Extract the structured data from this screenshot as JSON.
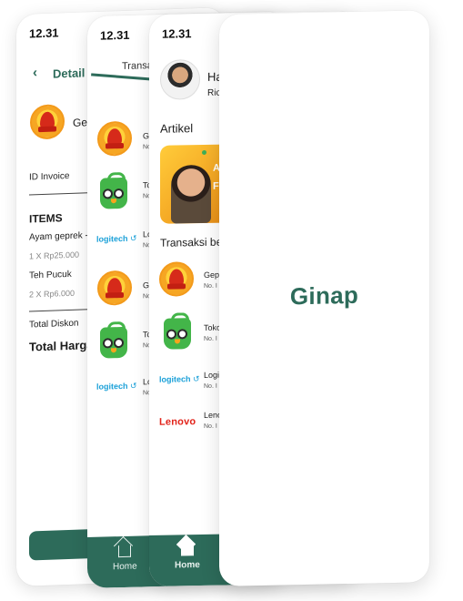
{
  "status_time": "12.31",
  "detail": {
    "title": "Detail T",
    "merchant": "Ge",
    "invoice_label": "ID Invoice",
    "items_title": "ITEMS",
    "items": [
      {
        "name": "Ayam geprek -",
        "qty": "1 X Rp25.000"
      },
      {
        "name": "Teh Pucuk",
        "qty": "2 X Rp6.000"
      }
    ],
    "total_discount_label": "Total Diskon",
    "total_price_label": "Total Harga"
  },
  "transactions_page": {
    "tab_title": "Transa",
    "rows": [
      {
        "brand": "geprek",
        "name": "Ge",
        "sub": "No"
      },
      {
        "brand": "tokopedia",
        "name": "To",
        "sub": "No"
      },
      {
        "brand": "logitech",
        "logo_text": "logitech",
        "name": "Lo",
        "sub": "No"
      },
      {
        "brand": "geprek",
        "name": "Ge",
        "sub": "No"
      },
      {
        "brand": "tokopedia",
        "name": "To",
        "sub": "No"
      },
      {
        "brand": "logitech",
        "logo_text": "logitech",
        "name": "Lo",
        "sub": "No"
      }
    ],
    "nav_home": "Home"
  },
  "home": {
    "greeting": "Ha",
    "greeting_sub": "Ric",
    "article_title": "Artikel",
    "banner_text": [
      "All t",
      "Fo"
    ],
    "recent_title": "Transaksi be",
    "rows": [
      {
        "brand": "geprek",
        "name": "Gep",
        "sub": "No. I"
      },
      {
        "brand": "tokopedia",
        "name": "Toko",
        "sub": "No. I"
      },
      {
        "brand": "logitech",
        "logo_text": "logitech",
        "name": "Logi",
        "sub": "No. I"
      },
      {
        "brand": "lenovo",
        "logo_text": "Lenovo",
        "name": "Leno",
        "sub": "No. I"
      }
    ],
    "nav_home": "Home"
  },
  "splash": {
    "brand": "Ginap"
  },
  "colors": {
    "primary": "#2d6b5a",
    "geprek": "#f6a623",
    "tokopedia": "#43b549",
    "logitech": "#1aa0d8",
    "lenovo": "#e2231a"
  }
}
